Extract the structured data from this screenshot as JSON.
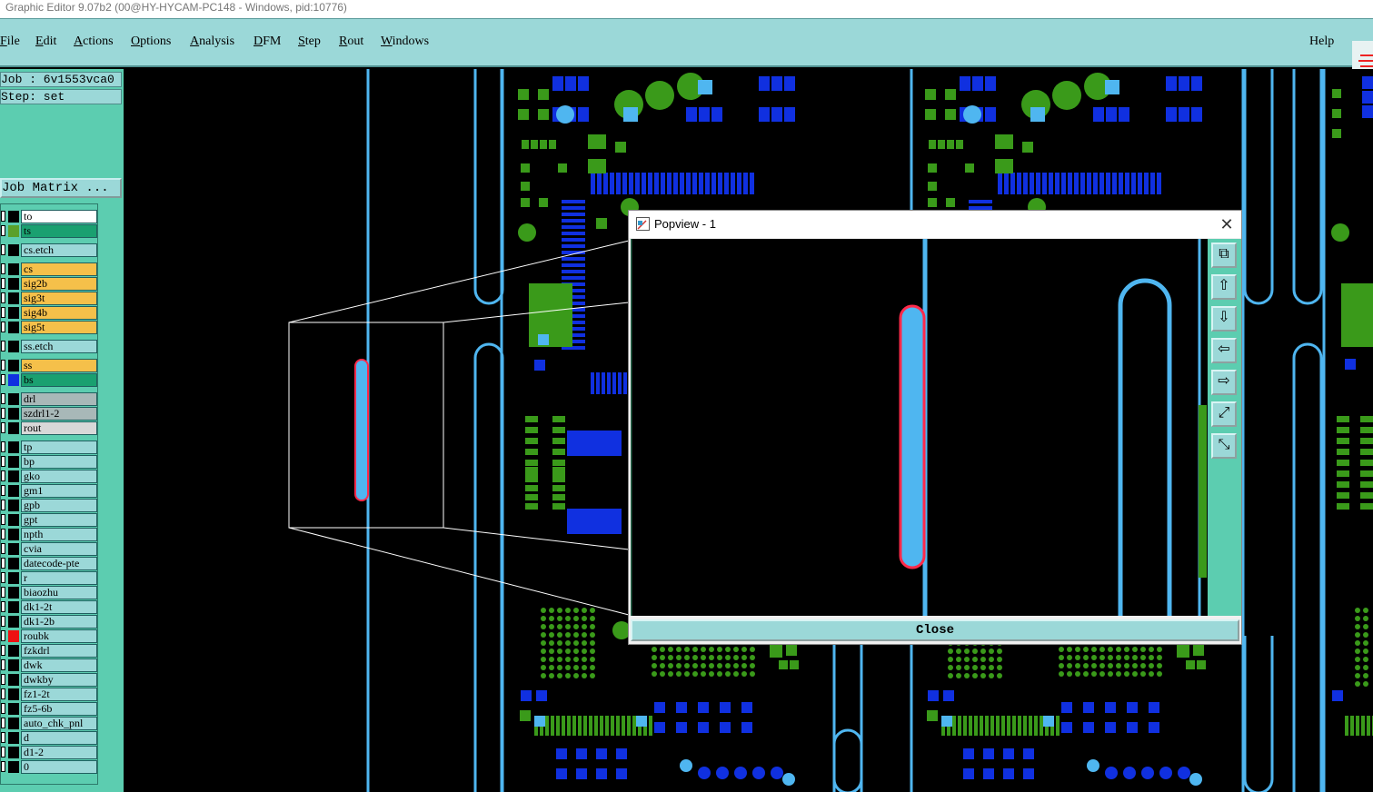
{
  "window": {
    "title": "Graphic Editor 9.07b2 (00@HY-HYCAM-PC148 - Windows, pid:10776)"
  },
  "menu": {
    "items": [
      "File",
      "Edit",
      "Actions",
      "Options",
      "Analysis",
      "DFM",
      "Step",
      "Rout",
      "Windows"
    ],
    "help": "Help"
  },
  "job": {
    "job_line": "Job : 6v1553vca0",
    "step_line": "Step: set",
    "matrix_button": "Job Matrix ..."
  },
  "layers": [
    {
      "name": "to",
      "bg": "#ffffff",
      "swatch": "#000000"
    },
    {
      "name": "ts",
      "bg": "#1aa070",
      "swatch": "#5aa02a"
    },
    {
      "name": "cs.etch",
      "bg": "#9bd8d8",
      "swatch": "#000000"
    },
    {
      "name": "cs",
      "bg": "#f5c04a",
      "swatch": "#000000"
    },
    {
      "name": "sig2b",
      "bg": "#f5c04a",
      "swatch": "#000000"
    },
    {
      "name": "sig3t",
      "bg": "#f5c04a",
      "swatch": "#000000"
    },
    {
      "name": "sig4b",
      "bg": "#f5c04a",
      "swatch": "#000000"
    },
    {
      "name": "sig5t",
      "bg": "#f5c04a",
      "swatch": "#000000"
    },
    {
      "name": "ss.etch",
      "bg": "#9bd8d8",
      "swatch": "#000000"
    },
    {
      "name": "ss",
      "bg": "#f5c04a",
      "swatch": "#000000"
    },
    {
      "name": "bs",
      "bg": "#1aa070",
      "swatch": "#1030e0"
    },
    {
      "name": "drl",
      "bg": "#a8b8b8",
      "swatch": "#000000"
    },
    {
      "name": "szdrl1-2",
      "bg": "#a8b8b8",
      "swatch": "#000000"
    },
    {
      "name": "rout",
      "bg": "#d8d8d8",
      "swatch": "#000000"
    },
    {
      "name": "tp",
      "bg": "#9bd8d8",
      "swatch": "#000000"
    },
    {
      "name": "bp",
      "bg": "#9bd8d8",
      "swatch": "#000000"
    },
    {
      "name": "gko",
      "bg": "#9bd8d8",
      "swatch": "#000000"
    },
    {
      "name": "gm1",
      "bg": "#9bd8d8",
      "swatch": "#000000"
    },
    {
      "name": "gpb",
      "bg": "#9bd8d8",
      "swatch": "#000000"
    },
    {
      "name": "gpt",
      "bg": "#9bd8d8",
      "swatch": "#000000"
    },
    {
      "name": "npth",
      "bg": "#9bd8d8",
      "swatch": "#000000"
    },
    {
      "name": "cvia",
      "bg": "#9bd8d8",
      "swatch": "#000000"
    },
    {
      "name": "datecode-pte",
      "bg": "#9bd8d8",
      "swatch": "#000000"
    },
    {
      "name": "r",
      "bg": "#9bd8d8",
      "swatch": "#000000"
    },
    {
      "name": "biaozhu",
      "bg": "#9bd8d8",
      "swatch": "#000000"
    },
    {
      "name": "dk1-2t",
      "bg": "#9bd8d8",
      "swatch": "#000000"
    },
    {
      "name": "dk1-2b",
      "bg": "#9bd8d8",
      "swatch": "#000000"
    },
    {
      "name": "roubk",
      "bg": "#9bd8d8",
      "swatch": "#ee1111"
    },
    {
      "name": "fzkdrl",
      "bg": "#9bd8d8",
      "swatch": "#000000"
    },
    {
      "name": "dwk",
      "bg": "#9bd8d8",
      "swatch": "#000000"
    },
    {
      "name": "dwkby",
      "bg": "#9bd8d8",
      "swatch": "#000000"
    },
    {
      "name": "fz1-2t",
      "bg": "#9bd8d8",
      "swatch": "#000000"
    },
    {
      "name": "fz5-6b",
      "bg": "#9bd8d8",
      "swatch": "#000000"
    },
    {
      "name": "auto_chk_pnl",
      "bg": "#9bd8d8",
      "swatch": "#000000"
    },
    {
      "name": "d",
      "bg": "#9bd8d8",
      "swatch": "#000000"
    },
    {
      "name": "d1-2",
      "bg": "#9bd8d8",
      "swatch": "#000000"
    },
    {
      "name": "0",
      "bg": "#9bd8d8",
      "swatch": "#000000"
    }
  ],
  "popup": {
    "title": "Popview - 1",
    "close_label": "Close",
    "tools": [
      "zoom-fit-icon",
      "pan-up-icon",
      "pan-down-icon",
      "pan-left-icon",
      "pan-right-icon",
      "zoom-in-icon",
      "zoom-out-icon"
    ]
  },
  "colors": {
    "panel": "#5ccdb0",
    "button": "#9bd8d8",
    "trace": "#4fb6f0",
    "pad_blue": "#1030e0",
    "pad_green": "#3a9a1a",
    "highlight": "#ff2a4a"
  }
}
